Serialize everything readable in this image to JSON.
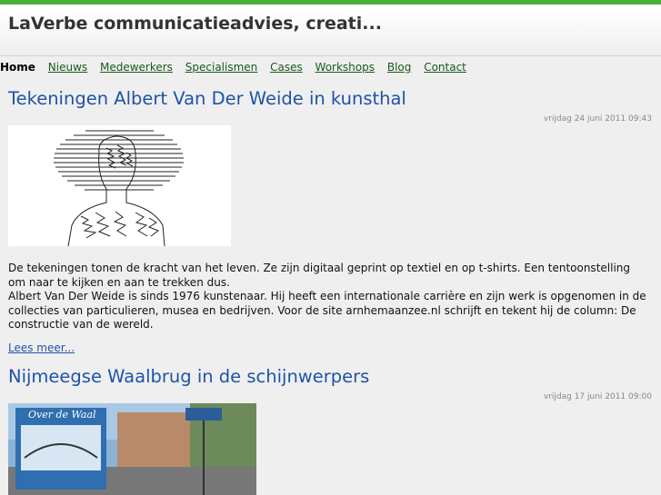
{
  "site": {
    "title": "LaVerbe communicatieadvies, creati..."
  },
  "nav": {
    "items": [
      {
        "label": "Home",
        "active": true
      },
      {
        "label": "Nieuws"
      },
      {
        "label": "Medewerkers"
      },
      {
        "label": "Specialismen"
      },
      {
        "label": "Cases"
      },
      {
        "label": "Workshops"
      },
      {
        "label": "Blog"
      },
      {
        "label": "Contact"
      }
    ]
  },
  "articles": [
    {
      "title": "Tekeningen Albert Van Der Weide in kunsthal",
      "date": "vrijdag 24 juni 2011 09:43",
      "paragraphs": [
        "De tekeningen tonen de kracht van het leven. Ze zijn digitaal geprint op textiel en op t-shirts. Een tentoonstelling  om naar te kijken en aan te trekken dus.",
        "Albert Van Der Weide is sinds 1976 kunstenaar. Hij heeft een internationale carrière en zijn werk is opgenomen in de collecties van particulieren, musea en bedrijven. Voor de site arnhemaanzee.nl schrijft en tekent hij de column: De constructie van de wereld."
      ],
      "read_more": "Lees meer..."
    },
    {
      "title": "Nijmeegse Waalbrug in de schijnwerpers",
      "date": "vrijdag 17 juni 2011 09:00",
      "image_sign_text": "Over de Waal"
    }
  ],
  "colors": {
    "topbar": "#45b135",
    "link": "#1f53a8",
    "nav_link": "#1a5a1a"
  }
}
